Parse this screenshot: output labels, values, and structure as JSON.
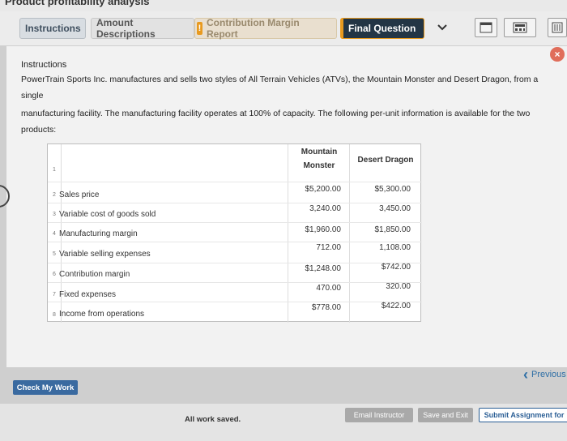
{
  "page": {
    "title": "Product profitability analysis"
  },
  "tabs": [
    {
      "label": "Instructions"
    },
    {
      "label": "Amount Descriptions"
    },
    {
      "label": "Contribution Margin Report",
      "badge": "!"
    },
    {
      "label": "Final Question"
    }
  ],
  "toolbar": {
    "icons": [
      "chevron-down-icon",
      "window-icon",
      "calculator-icon",
      "list-icon"
    ]
  },
  "instructions": {
    "heading": "Instructions",
    "line1": "PowerTrain Sports Inc. manufactures and sells two styles of All Terrain Vehicles (ATVs), the Mountain Monster and Desert Dragon, from a single",
    "line2": "manufacturing facility. The manufacturing facility operates at 100% of capacity. The following per-unit information is available for the two products:"
  },
  "sheet": {
    "headers": {
      "col1_line1": "Mountain",
      "col1_line2": "Monster",
      "col2": "Desert Dragon"
    },
    "rows": [
      {
        "num": "1",
        "label": "",
        "mm": "",
        "dd": ""
      },
      {
        "num": "2",
        "label": "Sales price",
        "mm": "$5,200.00",
        "dd": "$5,300.00"
      },
      {
        "num": "3",
        "label": "Variable cost of goods sold",
        "mm": "3,240.00",
        "dd": "3,450.00"
      },
      {
        "num": "4",
        "label": "Manufacturing margin",
        "mm": "$1,960.00",
        "dd": "$1,850.00"
      },
      {
        "num": "5",
        "label": "Variable selling expenses",
        "mm": "712.00",
        "dd": "1,108.00"
      },
      {
        "num": "6",
        "label": "Contribution margin",
        "mm": "$1,248.00",
        "dd": "$742.00"
      },
      {
        "num": "7",
        "label": "Fixed expenses",
        "mm": "470.00",
        "dd": "320.00"
      },
      {
        "num": "8",
        "label": "Income from operations",
        "mm": "$778.00",
        "dd": "$422.00"
      }
    ]
  },
  "actions": {
    "check": "Check My Work",
    "previous": "Previous",
    "saved": "All work saved.",
    "email": "Email Instructor",
    "save_exit": "Save and Exit",
    "submit": "Submit Assignment for"
  }
}
